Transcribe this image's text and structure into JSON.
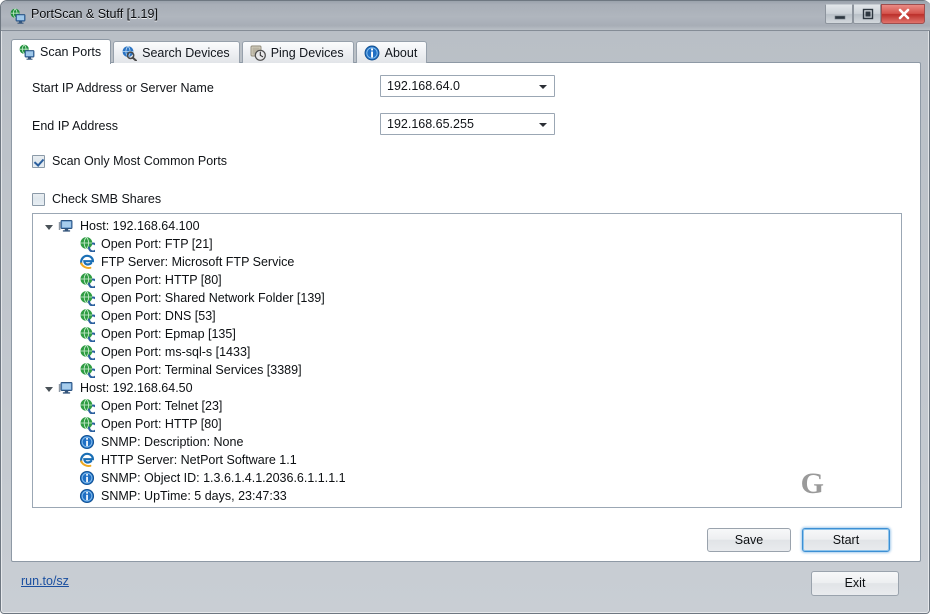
{
  "window": {
    "title": "PortScan & Stuff [1.19]",
    "icon": "app-network-monitor-icon",
    "controls": {
      "minimize": "minimize-icon",
      "maximize": "maximize-icon",
      "close": "close-icon"
    }
  },
  "tabs": [
    {
      "label": "Scan Ports",
      "icon": "network-monitor-icon",
      "active": true
    },
    {
      "label": "Search Devices",
      "icon": "globe-search-icon",
      "active": false
    },
    {
      "label": "Ping Devices",
      "icon": "stopwatch-icon",
      "active": false
    },
    {
      "label": "About",
      "icon": "info-icon",
      "active": false
    }
  ],
  "form": {
    "start_ip_label": "Start IP Address or Server Name",
    "start_ip_value": "192.168.64.0",
    "end_ip_label": "End IP Address",
    "end_ip_value": "192.168.65.255",
    "common_ports_label": "Scan Only Most Common Ports",
    "common_ports_checked": true,
    "smb_shares_label": "Check SMB Shares",
    "smb_shares_checked": false
  },
  "results": {
    "watermark": "G",
    "nodes": [
      {
        "level": "root",
        "icon": "host-computer-icon",
        "label": "Host: 192.168.64.100"
      },
      {
        "level": "child",
        "icon": "globe-port-icon",
        "label": "Open Port: FTP [21]"
      },
      {
        "level": "child",
        "icon": "browser-e-icon",
        "label": "FTP Server: Microsoft FTP Service"
      },
      {
        "level": "child",
        "icon": "globe-port-icon",
        "label": "Open Port: HTTP [80]"
      },
      {
        "level": "child",
        "icon": "globe-port-icon",
        "label": "Open Port: Shared Network Folder [139]"
      },
      {
        "level": "child",
        "icon": "globe-port-icon",
        "label": "Open Port: DNS [53]"
      },
      {
        "level": "child",
        "icon": "globe-port-icon",
        "label": "Open Port: Epmap [135]"
      },
      {
        "level": "child",
        "icon": "globe-port-icon",
        "label": "Open Port: ms-sql-s [1433]"
      },
      {
        "level": "child",
        "icon": "globe-port-icon",
        "label": "Open Port: Terminal Services [3389]"
      },
      {
        "level": "root",
        "icon": "host-computer-icon",
        "label": "Host: 192.168.64.50"
      },
      {
        "level": "child",
        "icon": "globe-port-icon",
        "label": "Open Port: Telnet [23]"
      },
      {
        "level": "child",
        "icon": "globe-port-icon",
        "label": "Open Port: HTTP [80]"
      },
      {
        "level": "child",
        "icon": "info-blue-icon",
        "label": "SNMP: Description: None"
      },
      {
        "level": "child",
        "icon": "browser-e-icon",
        "label": "HTTP Server: NetPort Software 1.1"
      },
      {
        "level": "child",
        "icon": "info-blue-icon",
        "label": "SNMP: Object ID: 1.3.6.1.4.1.2036.6.1.1.1.1"
      },
      {
        "level": "child",
        "icon": "info-blue-icon",
        "label": "SNMP: UpTime: 5 days, 23:47:33"
      }
    ]
  },
  "actions": {
    "save_label": "Save",
    "start_label": "Start",
    "exit_label": "Exit"
  },
  "footer": {
    "link_text": "run.to/sz"
  },
  "colors": {
    "accent_blue": "#3c8fd4",
    "link_blue": "#1a4fa0",
    "close_red": "#bb2f2a",
    "titlebar_gray": "#a8aeb7"
  }
}
